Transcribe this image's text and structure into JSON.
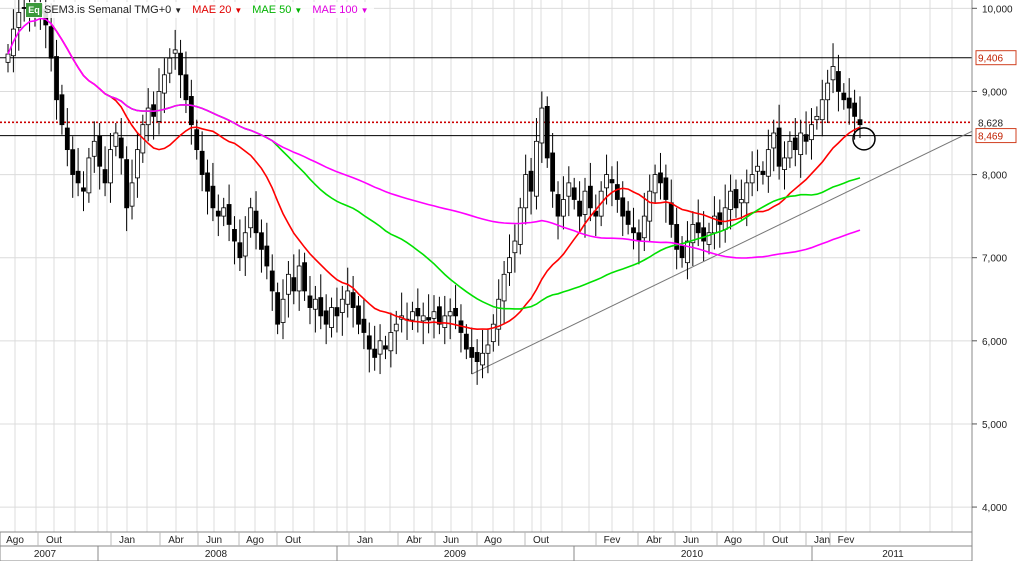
{
  "legend": {
    "logo": "Eq",
    "symbol": "SEM3.is Semanal TMG+0",
    "items": [
      {
        "label": "MAE 20",
        "color": "#ff0000"
      },
      {
        "label": "MAE 50",
        "color": "#00cc00"
      },
      {
        "label": "MAE 100",
        "color": "#ff00ff"
      }
    ]
  },
  "chart_data": {
    "type": "line",
    "ylim": [
      3.7,
      10.1
    ],
    "y_ticks": [
      "4,000",
      "5,000",
      "6,000",
      "7,000",
      "8,000",
      "9,000",
      "10,000"
    ],
    "y_tick_values": [
      4,
      5,
      6,
      7,
      8,
      9,
      10
    ],
    "x_month_ticks": [
      "Ago",
      "Out",
      "Jan",
      "Abr",
      "Jun",
      "Ago",
      "Out",
      "Jan",
      "Abr",
      "Jun",
      "Ago",
      "Out",
      "Fev",
      "Abr",
      "Jun",
      "Ago",
      "Out",
      "Jan",
      "Fev"
    ],
    "x_years": [
      "2007",
      "2008",
      "2009",
      "2010",
      "2011"
    ],
    "price_weekly_close": [
      9.45,
      9.75,
      9.95,
      10.0,
      10.05,
      9.9,
      10.05,
      9.8,
      9.4,
      8.9,
      8.6,
      8.3,
      8.0,
      7.9,
      7.8,
      8.2,
      8.4,
      8.1,
      7.9,
      8.3,
      8.5,
      8.2,
      7.6,
      7.9,
      8.3,
      8.6,
      8.8,
      8.7,
      9.0,
      9.2,
      9.4,
      9.5,
      9.2,
      8.9,
      8.6,
      8.3,
      8.0,
      7.8,
      7.6,
      7.5,
      7.6,
      7.4,
      7.2,
      7.0,
      7.3,
      7.6,
      7.3,
      7.1,
      6.9,
      6.6,
      6.2,
      6.5,
      6.8,
      6.6,
      6.9,
      6.6,
      6.4,
      6.5,
      6.3,
      6.2,
      6.4,
      6.3,
      6.5,
      6.6,
      6.4,
      6.2,
      6.1,
      5.9,
      5.8,
      6.0,
      5.9,
      6.1,
      6.2,
      6.3,
      6.25,
      6.35,
      6.3,
      6.3,
      6.25,
      6.35,
      6.2,
      6.3,
      6.35,
      6.3,
      6.1,
      5.9,
      5.8,
      5.75,
      5.85,
      5.95,
      6.2,
      6.5,
      6.8,
      7.0,
      7.2,
      7.6,
      8.0,
      7.8,
      8.4,
      8.8,
      8.2,
      7.8,
      7.5,
      7.7,
      7.9,
      7.7,
      7.5,
      7.8,
      7.6,
      7.5,
      7.8,
      8.0,
      7.9,
      7.7,
      7.5,
      7.4,
      7.3,
      7.2,
      7.5,
      7.8,
      8.0,
      7.9,
      7.7,
      7.4,
      7.1,
      7.0,
      7.2,
      7.4,
      7.3,
      7.2,
      7.3,
      7.5,
      7.4,
      7.6,
      7.8,
      7.6,
      7.7,
      7.9,
      8.0,
      8.1,
      8.0,
      8.3,
      8.5,
      8.1,
      8.2,
      8.4,
      8.3,
      8.5,
      8.4,
      8.6,
      8.7,
      8.9,
      9.1,
      9.3,
      9.0,
      8.9,
      8.8,
      8.7,
      8.6
    ],
    "horizontal_levels": [
      {
        "value": 9.406,
        "label": "9,406",
        "style": "solid",
        "color": "#000000"
      },
      {
        "value": 8.628,
        "label": "8,628",
        "style": "dotted",
        "color": "#cc0000"
      },
      {
        "value": 8.469,
        "label": "8,469",
        "style": "solid",
        "color": "#000000"
      }
    ],
    "trendline": {
      "from": [
        86,
        5.6
      ],
      "to": [
        194,
        9.0
      ]
    },
    "grid": true
  }
}
